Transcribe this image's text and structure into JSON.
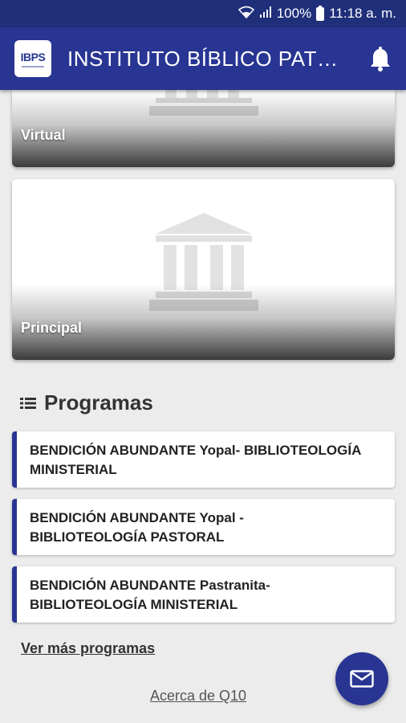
{
  "status_bar": {
    "battery": "100%",
    "time": "11:18 a. m.",
    "icons": [
      "wifi-icon",
      "signal-icon",
      "battery-icon"
    ]
  },
  "app_bar": {
    "logo_text": "IBPS",
    "title": "INSTITUTO BÍBLICO PATRI...",
    "notification_icon": "bell-icon"
  },
  "cards": [
    {
      "label": "Virtual",
      "icon": "building-icon"
    },
    {
      "label": "Principal",
      "icon": "building-icon"
    }
  ],
  "programs_section": {
    "title": "Programas",
    "icon": "list-icon",
    "items": [
      {
        "line1": "BENDICIÓN ABUNDANTE Yopal- BIBLIOTEOLOGÍA",
        "line2": "MINISTERIAL"
      },
      {
        "line1": "BENDICIÓN ABUNDANTE Yopal -",
        "line2": "BIBLIOTEOLOGÍA PASTORAL"
      },
      {
        "line1": "BENDICIÓN ABUNDANTE Pastranita-",
        "line2": "BIBLIOTEOLOGÍA MINISTERIAL"
      }
    ],
    "more_link": "Ver más programas"
  },
  "footer": {
    "about_link": "Acerca de Q10"
  },
  "fab": {
    "icon": "mail-icon"
  },
  "colors": {
    "primary": "#283593",
    "status_bar": "#1f2f7a",
    "background": "#ececec"
  }
}
